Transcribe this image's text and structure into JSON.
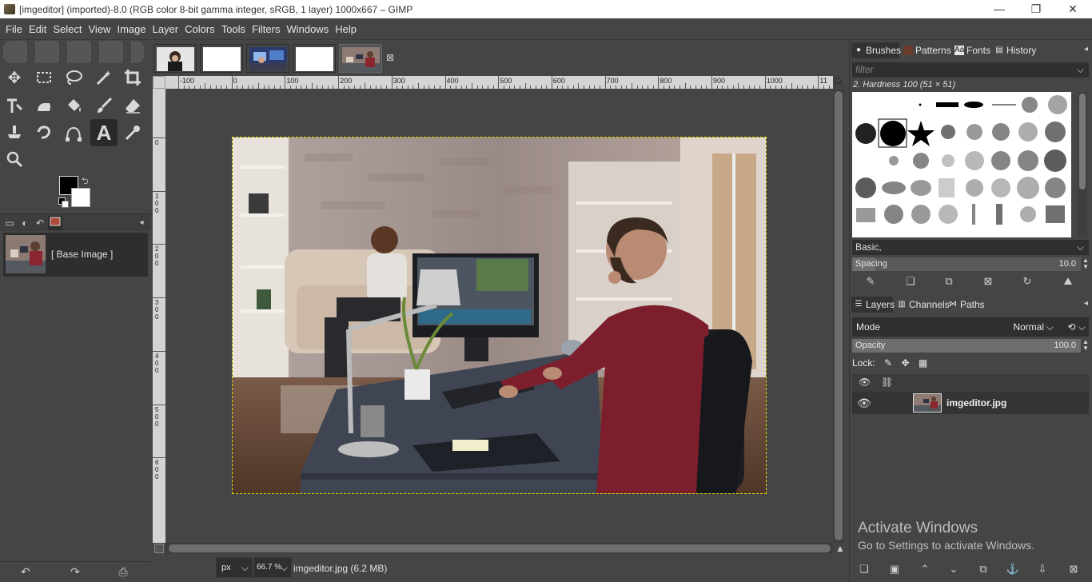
{
  "window": {
    "title": "[imgeditor] (imported)-8.0 (RGB color 8-bit gamma integer, sRGB, 1 layer) 1000x667 – GIMP",
    "minimize": "—",
    "maximize": "❐",
    "close": "✕"
  },
  "menu": [
    "File",
    "Edit",
    "Select",
    "View",
    "Image",
    "Layer",
    "Colors",
    "Tools",
    "Filters",
    "Windows",
    "Help"
  ],
  "toolbox": {
    "tools": [
      "move-tool",
      "rect-select-tool",
      "lasso-tool",
      "fuzzy-select-tool",
      "crop-tool",
      "unified-transform-tool",
      "warp-tool",
      "bucket-fill-tool",
      "paintbrush-tool",
      "eraser-tool",
      "clone-tool",
      "smudge-tool",
      "paths-tool",
      "text-tool",
      "color-picker-tool",
      "zoom-tool"
    ],
    "active_tool": "text-tool",
    "fg_color": "#000000",
    "bg_color": "#ffffff"
  },
  "images_panel": {
    "label": "[ Base Image ]"
  },
  "image_tabs": [
    "portrait-image",
    "blank-image-1",
    "office-image",
    "blank-image-2",
    "imgeditor-image"
  ],
  "rulers": {
    "h_labels": [
      "-100",
      "0",
      "100",
      "200",
      "300",
      "400",
      "500",
      "600",
      "700",
      "800",
      "900",
      "1000",
      "11"
    ],
    "v_labels": [
      "0",
      "100",
      "200",
      "300",
      "400",
      "500",
      "600"
    ]
  },
  "status": {
    "unit": "px",
    "zoom": "66.7 %",
    "file_info": "imgeditor.jpg (6.2 MB)"
  },
  "brushes_panel": {
    "tabs": [
      "Brushes",
      "Patterns",
      "Fonts",
      "History"
    ],
    "filter_placeholder": "filter",
    "brush_name": "2. Hardness 100 (51 × 51)",
    "brush_set": "Basic,",
    "spacing_label": "Spacing",
    "spacing_value": "10.0",
    "spacing_fraction": 0.1
  },
  "layers_panel": {
    "tabs": [
      "Layers",
      "Channels",
      "Paths"
    ],
    "mode_label": "Mode",
    "mode_value": "Normal",
    "opacity_label": "Opacity",
    "opacity_value": "100.0",
    "opacity_fraction": 1.0,
    "lock_label": "Lock:",
    "layers": [
      {
        "name": "imgeditor.jpg",
        "visible": true
      }
    ]
  },
  "watermark": {
    "line1": "Activate Windows",
    "line2": "Go to Settings to activate Windows."
  }
}
